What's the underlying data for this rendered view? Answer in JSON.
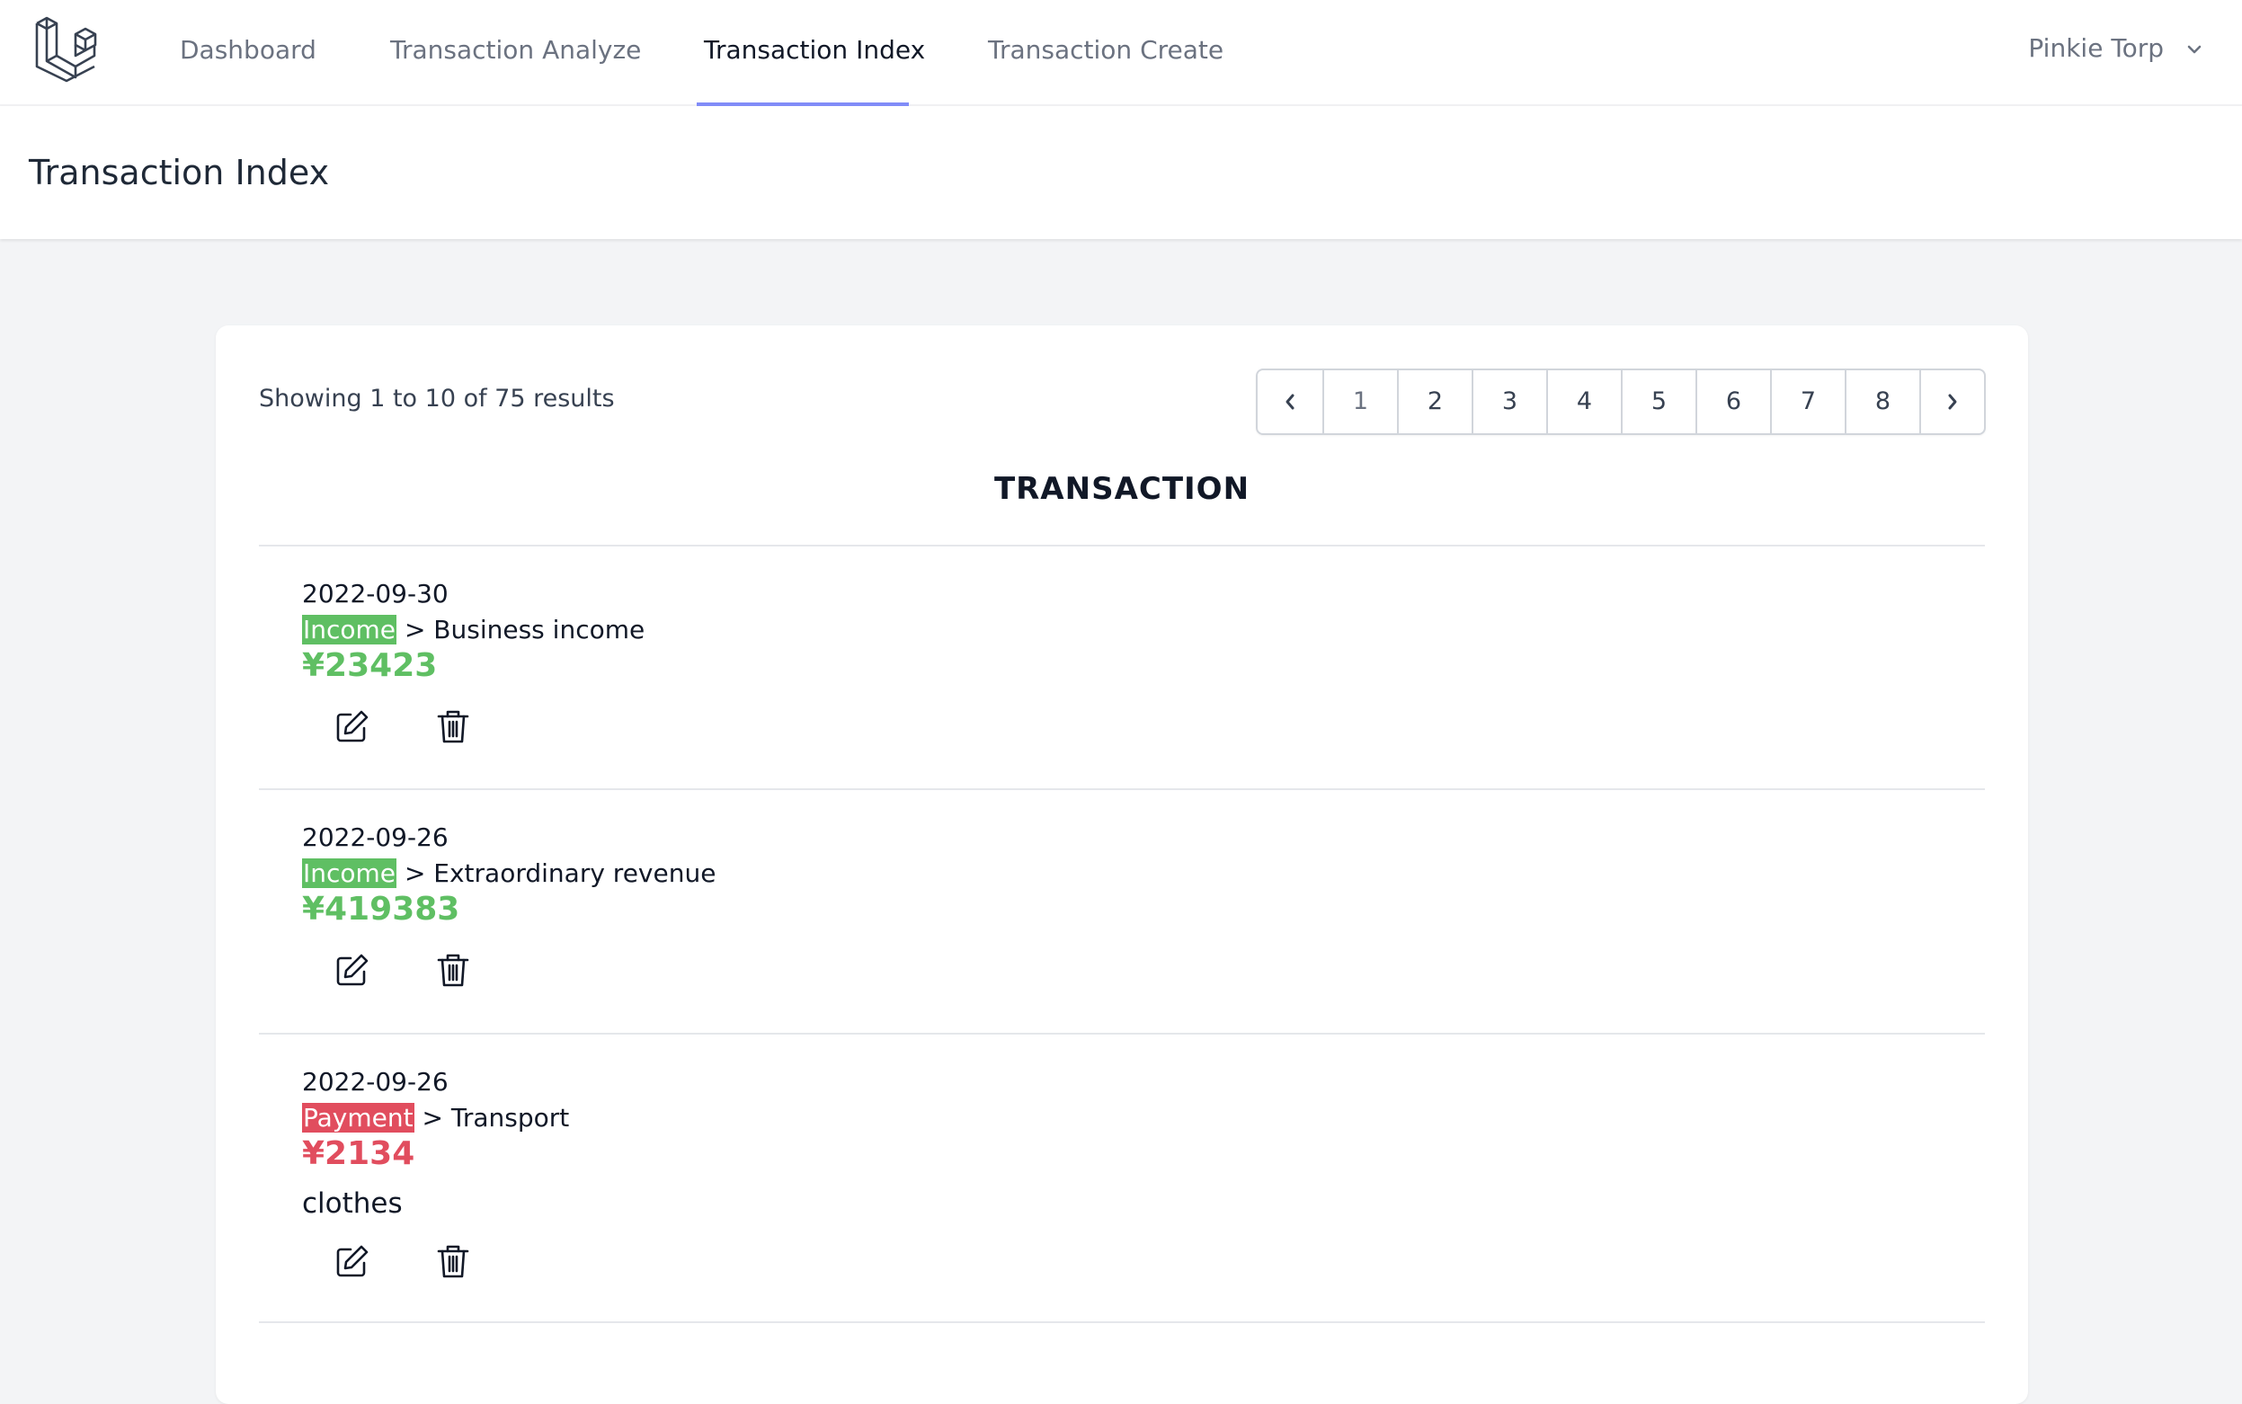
{
  "nav": {
    "links": [
      "Dashboard",
      "Transaction Analyze",
      "Transaction Index",
      "Transaction Create"
    ],
    "active_index": 2,
    "user_name": "Pinkie Torp"
  },
  "header": {
    "title": "Transaction Index"
  },
  "list": {
    "showing_text": "Showing 1 to 10 of 75 results",
    "pages": [
      "1",
      "2",
      "3",
      "4",
      "5",
      "6",
      "7",
      "8"
    ],
    "current_page": "1",
    "section_title": "TRANSACTION",
    "transactions": [
      {
        "date": "2022-09-30",
        "type": "Income",
        "category": "> Business income",
        "amount": "¥23423",
        "memo": ""
      },
      {
        "date": "2022-09-26",
        "type": "Income",
        "category": "> Extraordinary revenue",
        "amount": "¥419383",
        "memo": ""
      },
      {
        "date": "2022-09-26",
        "type": "Payment",
        "category": "> Transport",
        "amount": "¥2134",
        "memo": "clothes"
      }
    ]
  },
  "colors": {
    "income": "#5fbf63",
    "payment": "#e14d5e",
    "accent": "#818cf8"
  }
}
